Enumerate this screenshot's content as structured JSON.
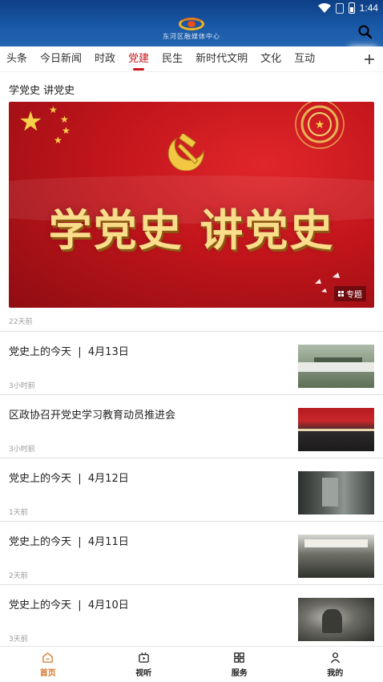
{
  "status": {
    "time": "1:44"
  },
  "header": {
    "logo_text": "东河区融媒体中心"
  },
  "tabs": [
    {
      "label": "头条"
    },
    {
      "label": "今日新闻"
    },
    {
      "label": "时政"
    },
    {
      "label": "党建",
      "active": true
    },
    {
      "label": "民生"
    },
    {
      "label": "新时代文明"
    },
    {
      "label": "文化"
    },
    {
      "label": "互动"
    }
  ],
  "feature": {
    "title": "学党史  讲党史",
    "banner_text": "学党史  讲党史",
    "badge": "专题",
    "time": "22天前"
  },
  "news": [
    {
      "title": "党史上的今天  |  4月13日",
      "time": "3小时前"
    },
    {
      "title": "区政协召开党史学习教育动员推进会",
      "time": "3小时前"
    },
    {
      "title": "党史上的今天  |  4月12日",
      "time": "1天前"
    },
    {
      "title": "党史上的今天  |  4月11日",
      "time": "2天前"
    },
    {
      "title": "党史上的今天  |  4月10日",
      "time": "3天前"
    }
  ],
  "bottom_nav": [
    {
      "label": "首页",
      "active": true
    },
    {
      "label": "视听"
    },
    {
      "label": "服务"
    },
    {
      "label": "我的"
    }
  ],
  "colors": {
    "header": "#1a5aa8",
    "accent": "#c8161d",
    "nav_active": "#d9762a"
  }
}
